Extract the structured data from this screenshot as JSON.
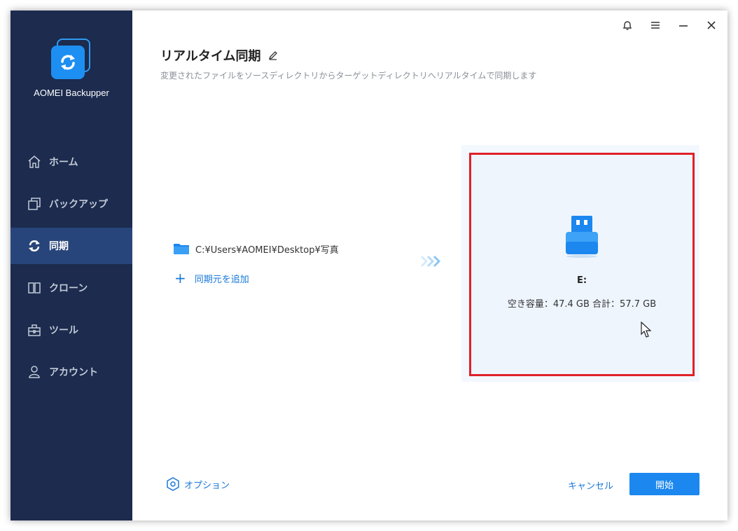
{
  "app": {
    "name": "AOMEI Backupper"
  },
  "sidebar": {
    "items": [
      {
        "label": "ホーム",
        "icon": "home-icon",
        "active": false
      },
      {
        "label": "バックアップ",
        "icon": "backup-icon",
        "active": false
      },
      {
        "label": "同期",
        "icon": "sync-icon",
        "active": true
      },
      {
        "label": "クローン",
        "icon": "clone-icon",
        "active": false
      },
      {
        "label": "ツール",
        "icon": "tools-icon",
        "active": false
      },
      {
        "label": "アカウント",
        "icon": "account-icon",
        "active": false
      }
    ]
  },
  "titlebar": {
    "icons": [
      "bell-icon",
      "menu-icon",
      "minimize-icon",
      "close-icon"
    ]
  },
  "page": {
    "title": "リアルタイム同期",
    "subtitle": "変更されたファイルをソースディレクトリからターゲットディレクトリへリアルタイムで同期します"
  },
  "source": {
    "path": "C:¥Users¥AOMEI¥Desktop¥写真",
    "add_label": "同期元を追加"
  },
  "target": {
    "drive": "E:",
    "capacity": "空き容量：47.4 GB 合計：57.7 GB"
  },
  "footer": {
    "options_label": "オプション",
    "cancel_label": "キャンセル",
    "start_label": "開始"
  },
  "colors": {
    "sidebar_bg": "#1c2b4e",
    "sidebar_active": "#27457a",
    "accent": "#1b87ef",
    "highlight_border": "#e0202a"
  }
}
